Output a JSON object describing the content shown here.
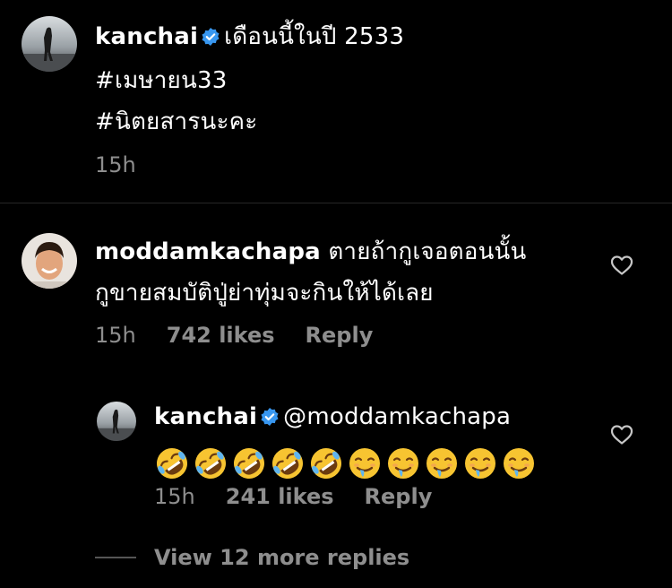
{
  "caption": {
    "username": "kanchai",
    "text_line1": "เดือนนี้ในปี 2533",
    "hashtag1": "#เมษายน33",
    "hashtag2": "#นิตยสารนะคะ",
    "time": "15h"
  },
  "comment": {
    "username": "moddamkachapa",
    "text_line1": "ตายถ้ากูเจอตอนนั้น",
    "text_line2": "กูขายสมบัติปู่ย่าทุ่มจะกินให้ได้เลย",
    "time": "15h",
    "likes": "742 likes",
    "reply_label": "Reply"
  },
  "reply": {
    "username": "kanchai",
    "mention": "@moddamkachapa",
    "emojis": [
      "rofl",
      "rofl",
      "rofl",
      "rofl",
      "rofl",
      "drooling",
      "drooling",
      "drooling",
      "drooling",
      "drooling"
    ],
    "time": "15h",
    "likes": "241 likes",
    "reply_label": "Reply"
  },
  "view_more": "View 12 more replies",
  "colors": {
    "background": "#000000",
    "text": "#ffffff",
    "secondary": "#8e8e8e",
    "verified": "#3897f0",
    "divider": "#262626"
  }
}
